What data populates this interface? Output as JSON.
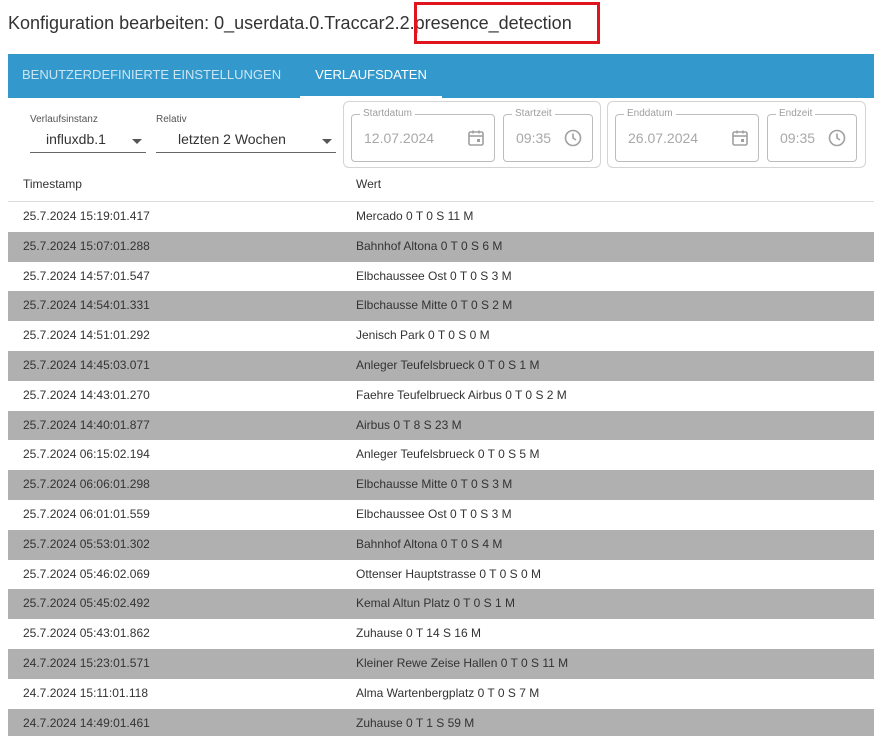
{
  "dialog": {
    "title_prefix": "Konfiguration bearbeiten: 0_userdata.0.Traccar2.2.",
    "title_highlight": "presence_detection"
  },
  "tabs": [
    {
      "label": "Benutzerdefinierte Einstellungen",
      "active": false
    },
    {
      "label": "Verlaufsdaten",
      "active": true
    }
  ],
  "filters": {
    "instance_label": "Verlaufsinstanz",
    "instance_value": "influxdb.1",
    "relative_label": "Relativ",
    "relative_value": "letzten 2 Wochen",
    "start_date_label": "Startdatum",
    "start_date_value": "12.07.2024",
    "start_time_label": "Startzeit",
    "start_time_value": "09:35",
    "end_date_label": "Enddatum",
    "end_date_value": "26.07.2024",
    "end_time_label": "Endzeit",
    "end_time_value": "09:35"
  },
  "table": {
    "columns": [
      "Timestamp",
      "Wert"
    ],
    "rows": [
      [
        "25.7.2024 15:19:01.417",
        "Mercado 0 T 0 S 11 M"
      ],
      [
        "25.7.2024 15:07:01.288",
        "Bahnhof Altona 0 T 0 S 6 M"
      ],
      [
        "25.7.2024 14:57:01.547",
        "Elbchaussee Ost 0 T 0 S 3 M"
      ],
      [
        "25.7.2024 14:54:01.331",
        "Elbchausse Mitte 0 T 0 S 2 M"
      ],
      [
        "25.7.2024 14:51:01.292",
        "Jenisch Park 0 T 0 S 0 M"
      ],
      [
        "25.7.2024 14:45:03.071",
        "Anleger Teufelsbrueck 0 T 0 S 1 M"
      ],
      [
        "25.7.2024 14:43:01.270",
        "Faehre Teufelbrueck Airbus 0 T 0 S 2 M"
      ],
      [
        "25.7.2024 14:40:01.877",
        "Airbus 0 T 8 S 23 M"
      ],
      [
        "25.7.2024 06:15:02.194",
        "Anleger Teufelsbrueck 0 T 0 S 5 M"
      ],
      [
        "25.7.2024 06:06:01.298",
        "Elbchausse Mitte 0 T 0 S 3 M"
      ],
      [
        "25.7.2024 06:01:01.559",
        "Elbchaussee Ost 0 T 0 S 3 M"
      ],
      [
        "25.7.2024 05:53:01.302",
        "Bahnhof Altona 0 T 0 S 4 M"
      ],
      [
        "25.7.2024 05:46:02.069",
        "Ottenser Hauptstrasse 0 T 0 S 0 M"
      ],
      [
        "25.7.2024 05:45:02.492",
        "Kemal Altun Platz 0 T 0 S 1 M"
      ],
      [
        "25.7.2024 05:43:01.862",
        "Zuhause 0 T 14 S 16 M"
      ],
      [
        "24.7.2024 15:23:01.571",
        "Kleiner Rewe Zeise Hallen 0 T 0 S 11 M"
      ],
      [
        "24.7.2024 15:11:01.118",
        "Alma Wartenbergplatz 0 T 0 S 7 M"
      ],
      [
        "24.7.2024 14:49:01.461",
        "Zuhause 0 T 1 S 59 M"
      ]
    ]
  },
  "colors": {
    "tab_bar": "#3399cc",
    "highlight_border": "#e0141c",
    "row_alternate": "#b0b0b0"
  },
  "icons": {
    "date_picker": "calendar-icon",
    "time_picker": "clock-icon",
    "select": "chevron-down-icon"
  }
}
